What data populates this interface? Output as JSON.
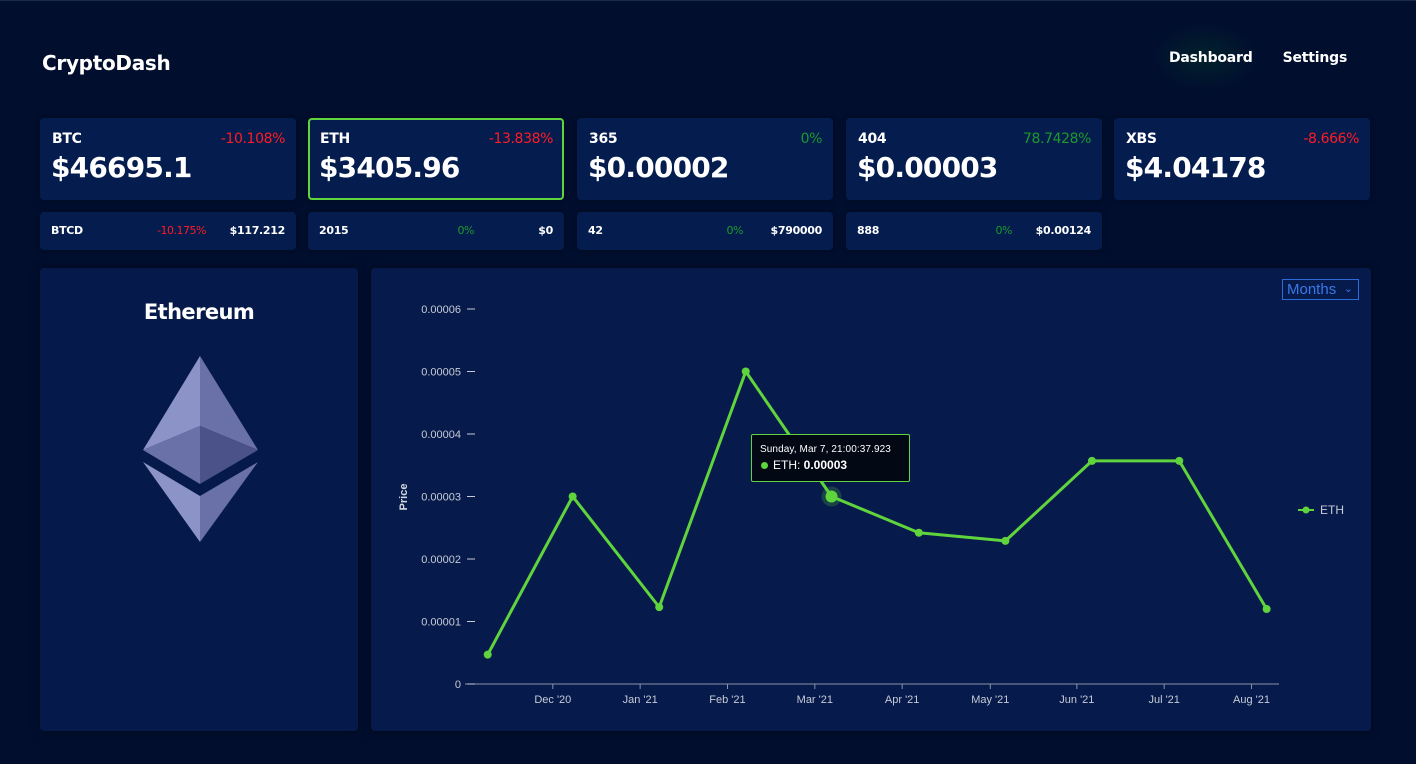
{
  "app": {
    "title": "CryptoDash",
    "nav": [
      {
        "label": "Dashboard"
      },
      {
        "label": "Settings"
      }
    ]
  },
  "tickers_main": [
    {
      "symbol": "BTC",
      "change": "-10.108%",
      "price": "$46695.1",
      "trend": "negative",
      "selected": false
    },
    {
      "symbol": "ETH",
      "change": "-13.838%",
      "price": "$3405.96",
      "trend": "negative",
      "selected": true
    },
    {
      "symbol": "365",
      "change": "0%",
      "price": "$0.00002",
      "trend": "zero",
      "selected": false
    },
    {
      "symbol": "404",
      "change": "78.7428%",
      "price": "$0.00003",
      "trend": "positive",
      "selected": false
    },
    {
      "symbol": "XBS",
      "change": "-8.666%",
      "price": "$4.04178",
      "trend": "negative",
      "selected": false
    }
  ],
  "tickers_small": [
    {
      "symbol": "BTCD",
      "change": "-10.175%",
      "price": "$117.212",
      "trend": "negative"
    },
    {
      "symbol": "2015",
      "change": "0%",
      "price": "$0",
      "trend": "zero"
    },
    {
      "symbol": "42",
      "change": "0%",
      "price": "$790000",
      "trend": "zero"
    },
    {
      "symbol": "888",
      "change": "0%",
      "price": "$0.00124",
      "trend": "zero"
    }
  ],
  "coin_panel": {
    "name": "Ethereum",
    "logo_icon": "ethereum-logo-icon"
  },
  "period_select": {
    "selected": "Months"
  },
  "tooltip": {
    "date": "Sunday, Mar 7, 21:00:37.923",
    "series": "ETH",
    "value": "0.00003"
  },
  "colors": {
    "background": "#010e2e",
    "card": "#051c4f",
    "accent_green": "#5fd43d",
    "negative": "#ff1c24",
    "positive": "#1c9a2a",
    "select_blue": "#3a78e8"
  },
  "chart_data": {
    "type": "line",
    "ylabel": "Price",
    "xlabel": "",
    "ylim": [
      0,
      6e-05
    ],
    "yticks": [
      "0",
      "0.00001",
      "0.00002",
      "0.00003",
      "0.00004",
      "0.00005",
      "0.00006"
    ],
    "xticks": [
      "Dec '20",
      "Jan '21",
      "Feb '21",
      "Mar '21",
      "Apr '21",
      "May '21",
      "Jun '21",
      "Jul '21",
      "Aug '21"
    ],
    "x": [
      "Nov 11 '20",
      "Dec 11 '20",
      "Jan 10 '21",
      "Feb 8 '21",
      "Mar 7 '21",
      "Apr 7 '21",
      "May 6 '21",
      "Jun 6 '21",
      "Jul 6 '21",
      "Aug 6 '21"
    ],
    "series": [
      {
        "name": "ETH",
        "color": "#5fd43d",
        "values": [
          4.7e-06,
          3e-05,
          1.23e-05,
          5e-05,
          3e-05,
          2.42e-05,
          2.29e-05,
          3.57e-05,
          3.57e-05,
          1.2e-05
        ]
      }
    ],
    "grid": false,
    "legend": "right"
  }
}
